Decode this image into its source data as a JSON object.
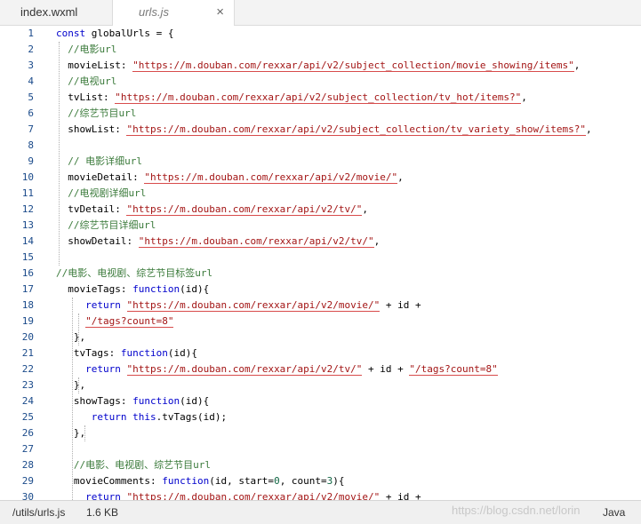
{
  "tabs": [
    {
      "label": "index.wxml",
      "active": false
    },
    {
      "label": "urls.js",
      "active": true
    }
  ],
  "tab_close_glyph": "×",
  "code_lines": [
    {
      "n": "1",
      "tokens": [
        {
          "t": "const",
          "c": "kw"
        },
        {
          "t": " globalUrls = {",
          "c": ""
        }
      ]
    },
    {
      "n": "2",
      "tokens": [
        {
          "t": "  //电影url",
          "c": "cm"
        }
      ]
    },
    {
      "n": "3",
      "tokens": [
        {
          "t": "  movieList: ",
          "c": ""
        },
        {
          "t": "\"https://m.douban.com/rexxar/api/v2/subject_collection/movie_showing/items\"",
          "c": "str"
        },
        {
          "t": ",",
          "c": ""
        }
      ]
    },
    {
      "n": "4",
      "tokens": [
        {
          "t": "  //电视url",
          "c": "cm"
        }
      ]
    },
    {
      "n": "5",
      "tokens": [
        {
          "t": "  tvList: ",
          "c": ""
        },
        {
          "t": "\"https://m.douban.com/rexxar/api/v2/subject_collection/tv_hot/items?\"",
          "c": "str"
        },
        {
          "t": ",",
          "c": ""
        }
      ]
    },
    {
      "n": "6",
      "tokens": [
        {
          "t": "  //综艺节目url",
          "c": "cm"
        }
      ]
    },
    {
      "n": "7",
      "tokens": [
        {
          "t": "  showList: ",
          "c": ""
        },
        {
          "t": "\"https://m.douban.com/rexxar/api/v2/subject_collection/tv_variety_show/items?\"",
          "c": "str"
        },
        {
          "t": ",",
          "c": ""
        }
      ]
    },
    {
      "n": "8",
      "tokens": []
    },
    {
      "n": "9",
      "tokens": [
        {
          "t": "  // 电影详细url",
          "c": "cm"
        }
      ]
    },
    {
      "n": "10",
      "tokens": [
        {
          "t": "  movieDetail: ",
          "c": ""
        },
        {
          "t": "\"https://m.douban.com/rexxar/api/v2/movie/\"",
          "c": "str"
        },
        {
          "t": ",",
          "c": ""
        }
      ]
    },
    {
      "n": "11",
      "tokens": [
        {
          "t": "  //电视剧详细url",
          "c": "cm"
        }
      ]
    },
    {
      "n": "12",
      "tokens": [
        {
          "t": "  tvDetail: ",
          "c": ""
        },
        {
          "t": "\"https://m.douban.com/rexxar/api/v2/tv/\"",
          "c": "str"
        },
        {
          "t": ",",
          "c": ""
        }
      ]
    },
    {
      "n": "13",
      "tokens": [
        {
          "t": "  //综艺节目详细url",
          "c": "cm"
        }
      ]
    },
    {
      "n": "14",
      "tokens": [
        {
          "t": "  showDetail: ",
          "c": ""
        },
        {
          "t": "\"https://m.douban.com/rexxar/api/v2/tv/\"",
          "c": "str"
        },
        {
          "t": ",",
          "c": ""
        }
      ]
    },
    {
      "n": "15",
      "tokens": []
    },
    {
      "n": "16",
      "tokens": [
        {
          "t": "//电影、电视剧、综艺节目标签url",
          "c": "cm"
        }
      ]
    },
    {
      "n": "17",
      "tokens": [
        {
          "t": "  movieTags: ",
          "c": ""
        },
        {
          "t": "function",
          "c": "kw"
        },
        {
          "t": "(id){",
          "c": ""
        }
      ]
    },
    {
      "n": "18",
      "tokens": [
        {
          "t": "     ",
          "c": ""
        },
        {
          "t": "return",
          "c": "kw"
        },
        {
          "t": " ",
          "c": ""
        },
        {
          "t": "\"https://m.douban.com/rexxar/api/v2/movie/\"",
          "c": "str"
        },
        {
          "t": " + id +",
          "c": ""
        }
      ]
    },
    {
      "n": "19",
      "tokens": [
        {
          "t": "     ",
          "c": ""
        },
        {
          "t": "\"/tags?count=8\"",
          "c": "str"
        }
      ]
    },
    {
      "n": "20",
      "tokens": [
        {
          "t": "   },",
          "c": ""
        }
      ]
    },
    {
      "n": "21",
      "tokens": [
        {
          "t": "   tvTags: ",
          "c": ""
        },
        {
          "t": "function",
          "c": "kw"
        },
        {
          "t": "(id){",
          "c": ""
        }
      ]
    },
    {
      "n": "22",
      "tokens": [
        {
          "t": "     ",
          "c": ""
        },
        {
          "t": "return",
          "c": "kw"
        },
        {
          "t": " ",
          "c": ""
        },
        {
          "t": "\"https://m.douban.com/rexxar/api/v2/tv/\"",
          "c": "str"
        },
        {
          "t": " + id + ",
          "c": ""
        },
        {
          "t": "\"/tags?count=8\"",
          "c": "str"
        }
      ]
    },
    {
      "n": "23",
      "tokens": [
        {
          "t": "   },",
          "c": ""
        }
      ]
    },
    {
      "n": "24",
      "tokens": [
        {
          "t": "   showTags: ",
          "c": ""
        },
        {
          "t": "function",
          "c": "kw"
        },
        {
          "t": "(id){",
          "c": ""
        }
      ]
    },
    {
      "n": "25",
      "tokens": [
        {
          "t": "      ",
          "c": ""
        },
        {
          "t": "return",
          "c": "kw"
        },
        {
          "t": " ",
          "c": ""
        },
        {
          "t": "this",
          "c": "kw"
        },
        {
          "t": ".tvTags(id);",
          "c": ""
        }
      ]
    },
    {
      "n": "26",
      "tokens": [
        {
          "t": "   },",
          "c": ""
        }
      ]
    },
    {
      "n": "27",
      "tokens": []
    },
    {
      "n": "28",
      "tokens": [
        {
          "t": "   //电影、电视剧、综艺节目url",
          "c": "cm"
        }
      ]
    },
    {
      "n": "29",
      "tokens": [
        {
          "t": "   movieComments: ",
          "c": ""
        },
        {
          "t": "function",
          "c": "kw"
        },
        {
          "t": "(id, start=",
          "c": ""
        },
        {
          "t": "0",
          "c": "num"
        },
        {
          "t": ", count=",
          "c": ""
        },
        {
          "t": "3",
          "c": "num"
        },
        {
          "t": "){",
          "c": ""
        }
      ]
    },
    {
      "n": "30",
      "tokens": [
        {
          "t": "     ",
          "c": ""
        },
        {
          "t": "return",
          "c": "kw"
        },
        {
          "t": " ",
          "c": ""
        },
        {
          "t": "\"https://m.douban.com/rexxar/api/v2/movie/\"",
          "c": "str"
        },
        {
          "t": " + id +",
          "c": ""
        }
      ]
    }
  ],
  "status": {
    "path": "/utils/urls.js",
    "size": "1.6 KB",
    "watermark": "https://blog.csdn.net/lorin",
    "language": "Java"
  },
  "colors": {
    "keyword": "#0000cc",
    "string": "#a31515",
    "comment": "#3a7a3a",
    "number": "#116644",
    "line_number": "#1a4a8a"
  }
}
